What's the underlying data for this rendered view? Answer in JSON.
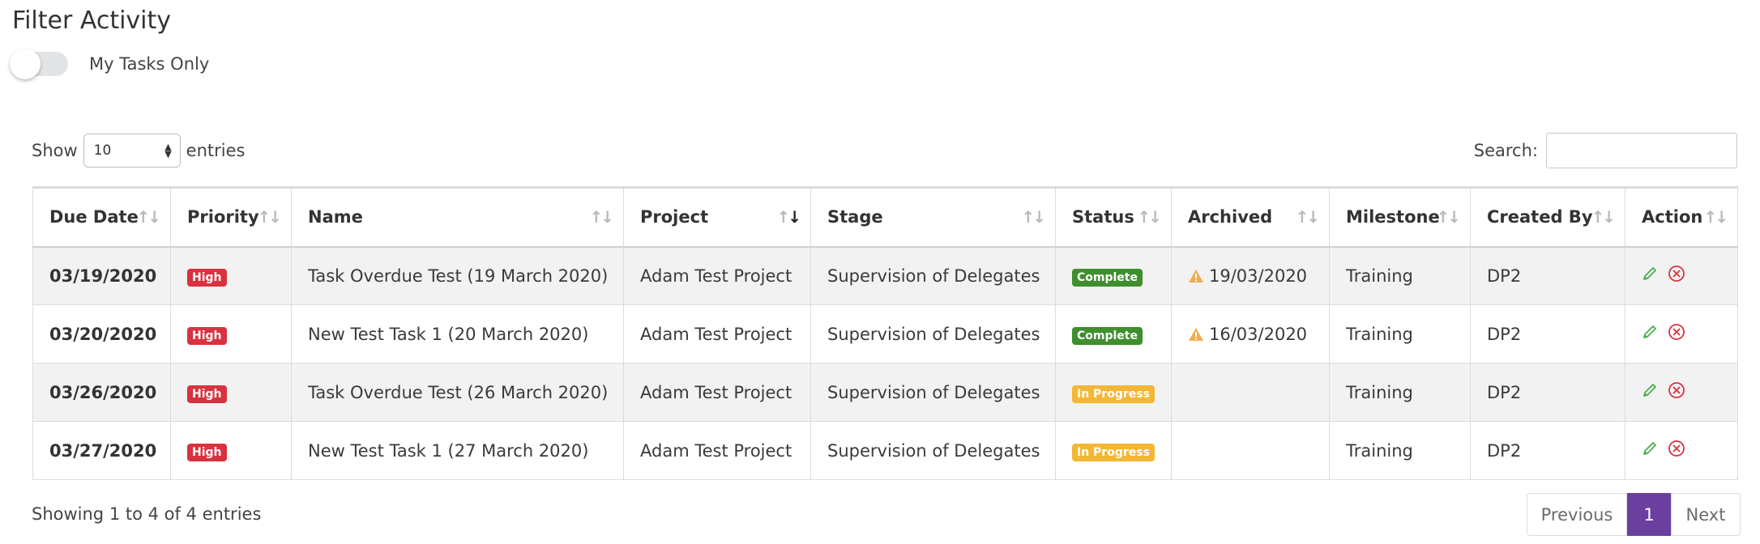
{
  "page_title": "Filter Activity",
  "toggle": {
    "label": "My Tasks Only",
    "on": false
  },
  "length_menu": {
    "prefix": "Show",
    "value": "10",
    "suffix": "entries"
  },
  "search": {
    "label": "Search:",
    "value": ""
  },
  "columns": [
    {
      "label": "Due Date",
      "sort": "none"
    },
    {
      "label": "Priority",
      "sort": "none"
    },
    {
      "label": "Name",
      "sort": "none"
    },
    {
      "label": "Project",
      "sort": "desc"
    },
    {
      "label": "Stage",
      "sort": "none"
    },
    {
      "label": "Status",
      "sort": "none"
    },
    {
      "label": "Archived",
      "sort": "none"
    },
    {
      "label": "Milestone",
      "sort": "none"
    },
    {
      "label": "Created By",
      "sort": "none"
    },
    {
      "label": "Action",
      "sort": "none"
    }
  ],
  "rows": [
    {
      "due_date": "03/19/2020",
      "priority": "High",
      "name": "Task Overdue Test (19 March 2020)",
      "project": "Adam Test Project",
      "stage": "Supervision of Delegates",
      "status": "Complete",
      "archived": "19/03/2020",
      "milestone": "Training",
      "created_by": "DP2"
    },
    {
      "due_date": "03/20/2020",
      "priority": "High",
      "name": "New Test Task 1 (20 March 2020)",
      "project": "Adam Test Project",
      "stage": "Supervision of Delegates",
      "status": "Complete",
      "archived": "16/03/2020",
      "milestone": "Training",
      "created_by": "DP2"
    },
    {
      "due_date": "03/26/2020",
      "priority": "High",
      "name": "Task Overdue Test (26 March 2020)",
      "project": "Adam Test Project",
      "stage": "Supervision of Delegates",
      "status": "In Progress",
      "archived": "",
      "milestone": "Training",
      "created_by": "DP2"
    },
    {
      "due_date": "03/27/2020",
      "priority": "High",
      "name": "New Test Task 1 (27 March 2020)",
      "project": "Adam Test Project",
      "stage": "Supervision of Delegates",
      "status": "In Progress",
      "archived": "",
      "milestone": "Training",
      "created_by": "DP2"
    }
  ],
  "info": "Showing 1 to 4 of 4 entries",
  "pagination": {
    "previous": "Previous",
    "current": "1",
    "next": "Next"
  },
  "colors": {
    "high": "#d9323f",
    "complete": "#3f8f2e",
    "in_progress": "#f4b733",
    "warning": "#f0ad4e",
    "edit": "#4caf50",
    "delete": "#d9323f",
    "page_active": "#6b3fa0"
  },
  "icons": {
    "archived": "warning-icon",
    "edit": "pencil-icon",
    "delete": "close-circle-icon",
    "sort": "sort-arrows-icon"
  }
}
